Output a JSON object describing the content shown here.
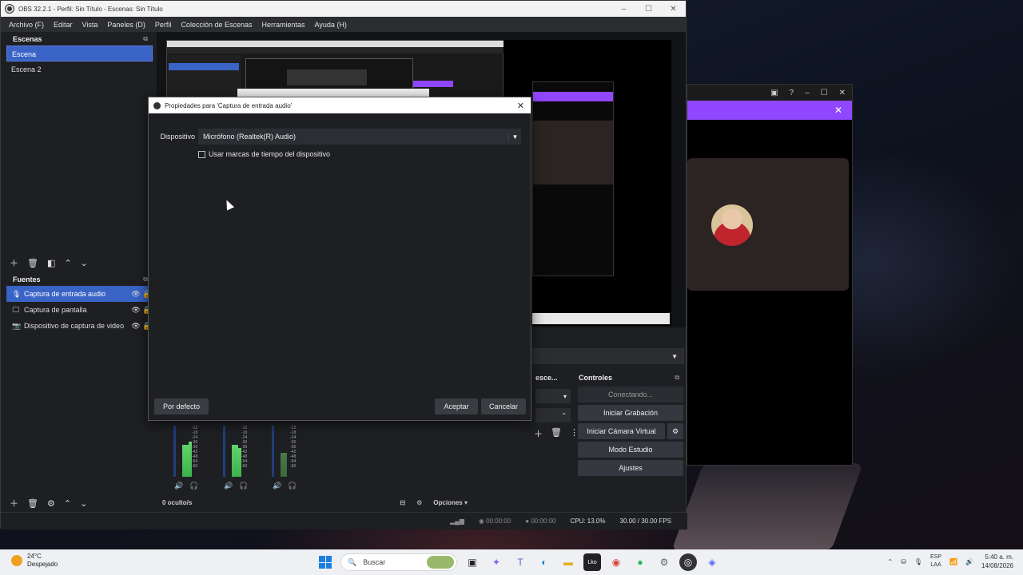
{
  "window": {
    "title": "OBS 32.2.1 - Perfil: Sin Título - Escenas: Sin Título",
    "min": "–",
    "max": "☐",
    "close": "✕"
  },
  "menu": [
    "Archivo (F)",
    "Editar",
    "Vista",
    "Paneles (D)",
    "Perfil",
    "Colección de Escenas",
    "Herramientas",
    "Ayuda (H)"
  ],
  "scenes": {
    "header": "Escenas",
    "items": [
      {
        "label": "Escena",
        "selected": true
      },
      {
        "label": "Escena 2",
        "selected": false
      }
    ]
  },
  "sources": {
    "header": "Fuentes",
    "items": [
      {
        "label": "Captura de entrada audio",
        "icon": "microphone-icon",
        "glyph": "🎙",
        "selected": true
      },
      {
        "label": "Captura de pantalla",
        "icon": "monitor-icon",
        "glyph": "🖵",
        "selected": false
      },
      {
        "label": "Dispositivo de captura de video",
        "icon": "camera-icon",
        "glyph": "📷",
        "selected": false
      }
    ]
  },
  "transitions": {
    "header": "Transiciones de esce...",
    "header_short": "esce..."
  },
  "controls": {
    "header": "Controles",
    "connecting": "Conectando...",
    "start_recording": "Iniciar Grabación",
    "start_virtual_cam": "Iniciar Cámara Virtual",
    "studio_mode": "Modo Estudio",
    "settings": "Ajustes"
  },
  "mixer": {
    "scale": [
      "-12",
      "-18",
      "-24",
      "-30",
      "-36",
      "-42",
      "-48",
      "-54",
      "-60"
    ],
    "hidden_label": "0 oculto/s",
    "options": "Opciones"
  },
  "status": {
    "rec_time": "00:00:00",
    "stream_time": "00:00:00",
    "cpu": "CPU: 13.0%",
    "fps": "30.00 / 30.00 FPS"
  },
  "dialog": {
    "title": "Propiedades para 'Captura de entrada audio'",
    "device_label": "Dispositivo",
    "device_value": "Micrófono (Realtek(R) Audio)",
    "checkbox_label": "Usar marcas de tiempo del dispositivo",
    "checkbox_checked": false,
    "defaults_button": "Por defecto",
    "ok_button": "Aceptar",
    "cancel_button": "Cancelar"
  },
  "taskbar": {
    "weather_temp": "24°C",
    "weather_desc": "Despejado",
    "search_placeholder": "Buscar",
    "lang_top": "ESP",
    "lang_bottom": "LAA",
    "time": "5:40 a. m.",
    "date": "14/08/2026"
  },
  "colors": {
    "accent": "#3a63c6",
    "purple": "#9146ff",
    "panel": "#1e1f22"
  }
}
